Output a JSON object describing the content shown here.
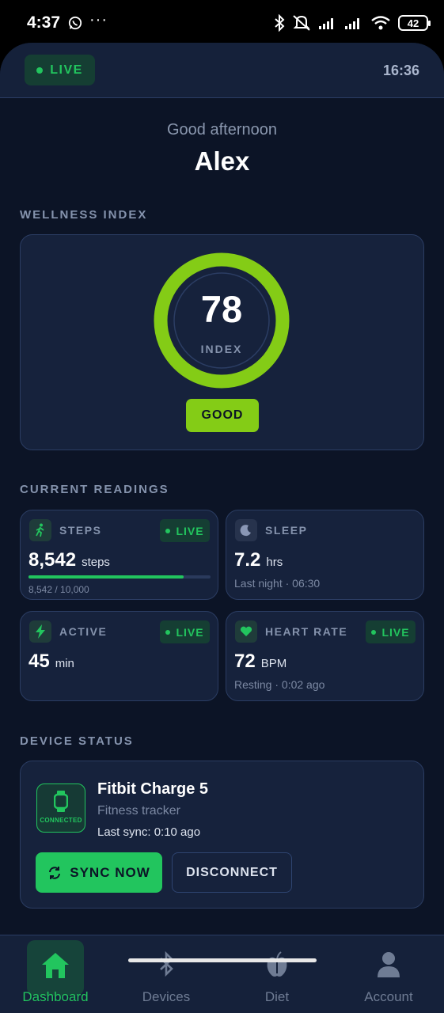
{
  "status_bar": {
    "time": "4:37",
    "more": "···",
    "battery": "42"
  },
  "header": {
    "live_label": "LIVE",
    "clock": "16:36"
  },
  "greeting": {
    "text": "Good afternoon",
    "name": "Alex"
  },
  "wellness": {
    "section_label": "WELLNESS INDEX",
    "score": "78",
    "score_label": "INDEX",
    "status_label": "GOOD",
    "ring_fraction": 1.0
  },
  "readings": {
    "section_label": "CURRENT READINGS",
    "steps": {
      "title": "STEPS",
      "live": "LIVE",
      "value": "8,542",
      "unit": "steps",
      "progress_text": "8,542 / 10,000",
      "progress_fraction": 0.8542
    },
    "sleep": {
      "title": "SLEEP",
      "value": "7.2",
      "unit": "hrs",
      "sub": "Last night · 06:30"
    },
    "active": {
      "title": "ACTIVE",
      "live": "LIVE",
      "value": "45",
      "unit": "min"
    },
    "heart": {
      "title": "HEART RATE",
      "live": "LIVE",
      "value": "72",
      "unit": "BPM",
      "sub": "Resting · 0:02 ago"
    }
  },
  "device": {
    "section_label": "DEVICE STATUS",
    "badge": "CONNECTED",
    "name": "Fitbit Charge 5",
    "type": "Fitness tracker",
    "last_sync": "Last sync: 0:10 ago",
    "sync_label": "SYNC NOW",
    "disconnect_label": "DISCONNECT"
  },
  "nav": {
    "items": [
      {
        "label": "Dashboard",
        "icon": "home-icon",
        "active": true
      },
      {
        "label": "Devices",
        "icon": "bluetooth-icon",
        "active": false
      },
      {
        "label": "Diet",
        "icon": "apple-icon",
        "active": false
      },
      {
        "label": "Account",
        "icon": "person-icon",
        "active": false
      }
    ]
  },
  "colors": {
    "accent": "#22c55e",
    "wellness": "#84cc16",
    "background": "#0c1426",
    "card": "#16223c"
  }
}
